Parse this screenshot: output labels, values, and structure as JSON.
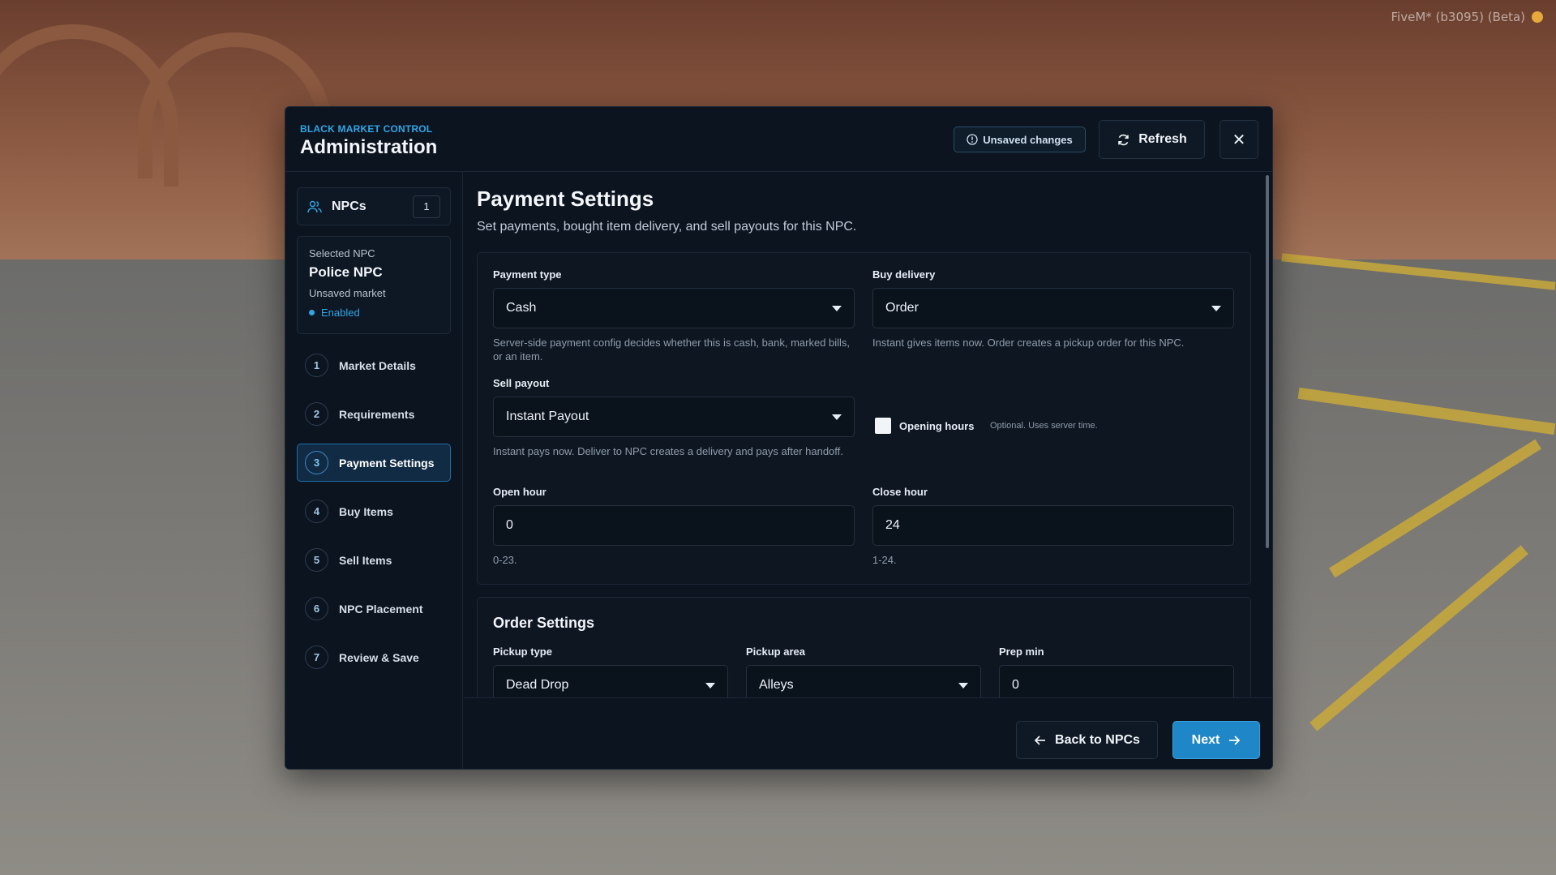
{
  "watermark": "FiveM* (b3095) (Beta)",
  "header": {
    "eyebrow": "BLACK MARKET CONTROL",
    "title": "Administration",
    "unsaved_label": "Unsaved changes",
    "refresh_label": "Refresh",
    "close_glyph": "✕"
  },
  "sidebar": {
    "npcs_label": "NPCs",
    "npcs_count": "1",
    "selected_label": "Selected NPC",
    "npc_name": "Police NPC",
    "market_label": "Unsaved market",
    "status_label": "Enabled",
    "steps": [
      {
        "num": "1",
        "label": "Market Details"
      },
      {
        "num": "2",
        "label": "Requirements"
      },
      {
        "num": "3",
        "label": "Payment Settings"
      },
      {
        "num": "4",
        "label": "Buy Items"
      },
      {
        "num": "5",
        "label": "Sell Items"
      },
      {
        "num": "6",
        "label": "NPC Placement"
      },
      {
        "num": "7",
        "label": "Review & Save"
      }
    ],
    "active_step": 3
  },
  "main": {
    "title": "Payment Settings",
    "subtitle": "Set payments, bought item delivery, and sell payouts for this NPC.",
    "payment_type": {
      "label": "Payment type",
      "value": "Cash",
      "hint": "Server-side payment config decides whether this is cash, bank, marked bills, or an item."
    },
    "buy_delivery": {
      "label": "Buy delivery",
      "value": "Order",
      "hint": "Instant gives items now. Order creates a pickup order for this NPC."
    },
    "sell_payout": {
      "label": "Sell payout",
      "value": "Instant Payout",
      "hint": "Instant pays now. Deliver to NPC creates a delivery and pays after handoff."
    },
    "opening_hours": {
      "label": "Opening hours",
      "note": "Optional. Uses server time."
    },
    "open_hour": {
      "label": "Open hour",
      "value": "0",
      "hint": "0-23."
    },
    "close_hour": {
      "label": "Close hour",
      "value": "24",
      "hint": "1-24."
    },
    "order_settings": {
      "title": "Order Settings",
      "pickup_type": {
        "label": "Pickup type",
        "value": "Dead Drop"
      },
      "pickup_area": {
        "label": "Pickup area",
        "value": "Alleys"
      },
      "prep_min": {
        "label": "Prep min",
        "value": "0"
      }
    }
  },
  "footer": {
    "back_label": "Back to NPCs",
    "next_label": "Next"
  },
  "colors": {
    "accent": "#2fa6e6",
    "primary_button": "#1f87c7",
    "panel_bg": "#0c1420"
  }
}
